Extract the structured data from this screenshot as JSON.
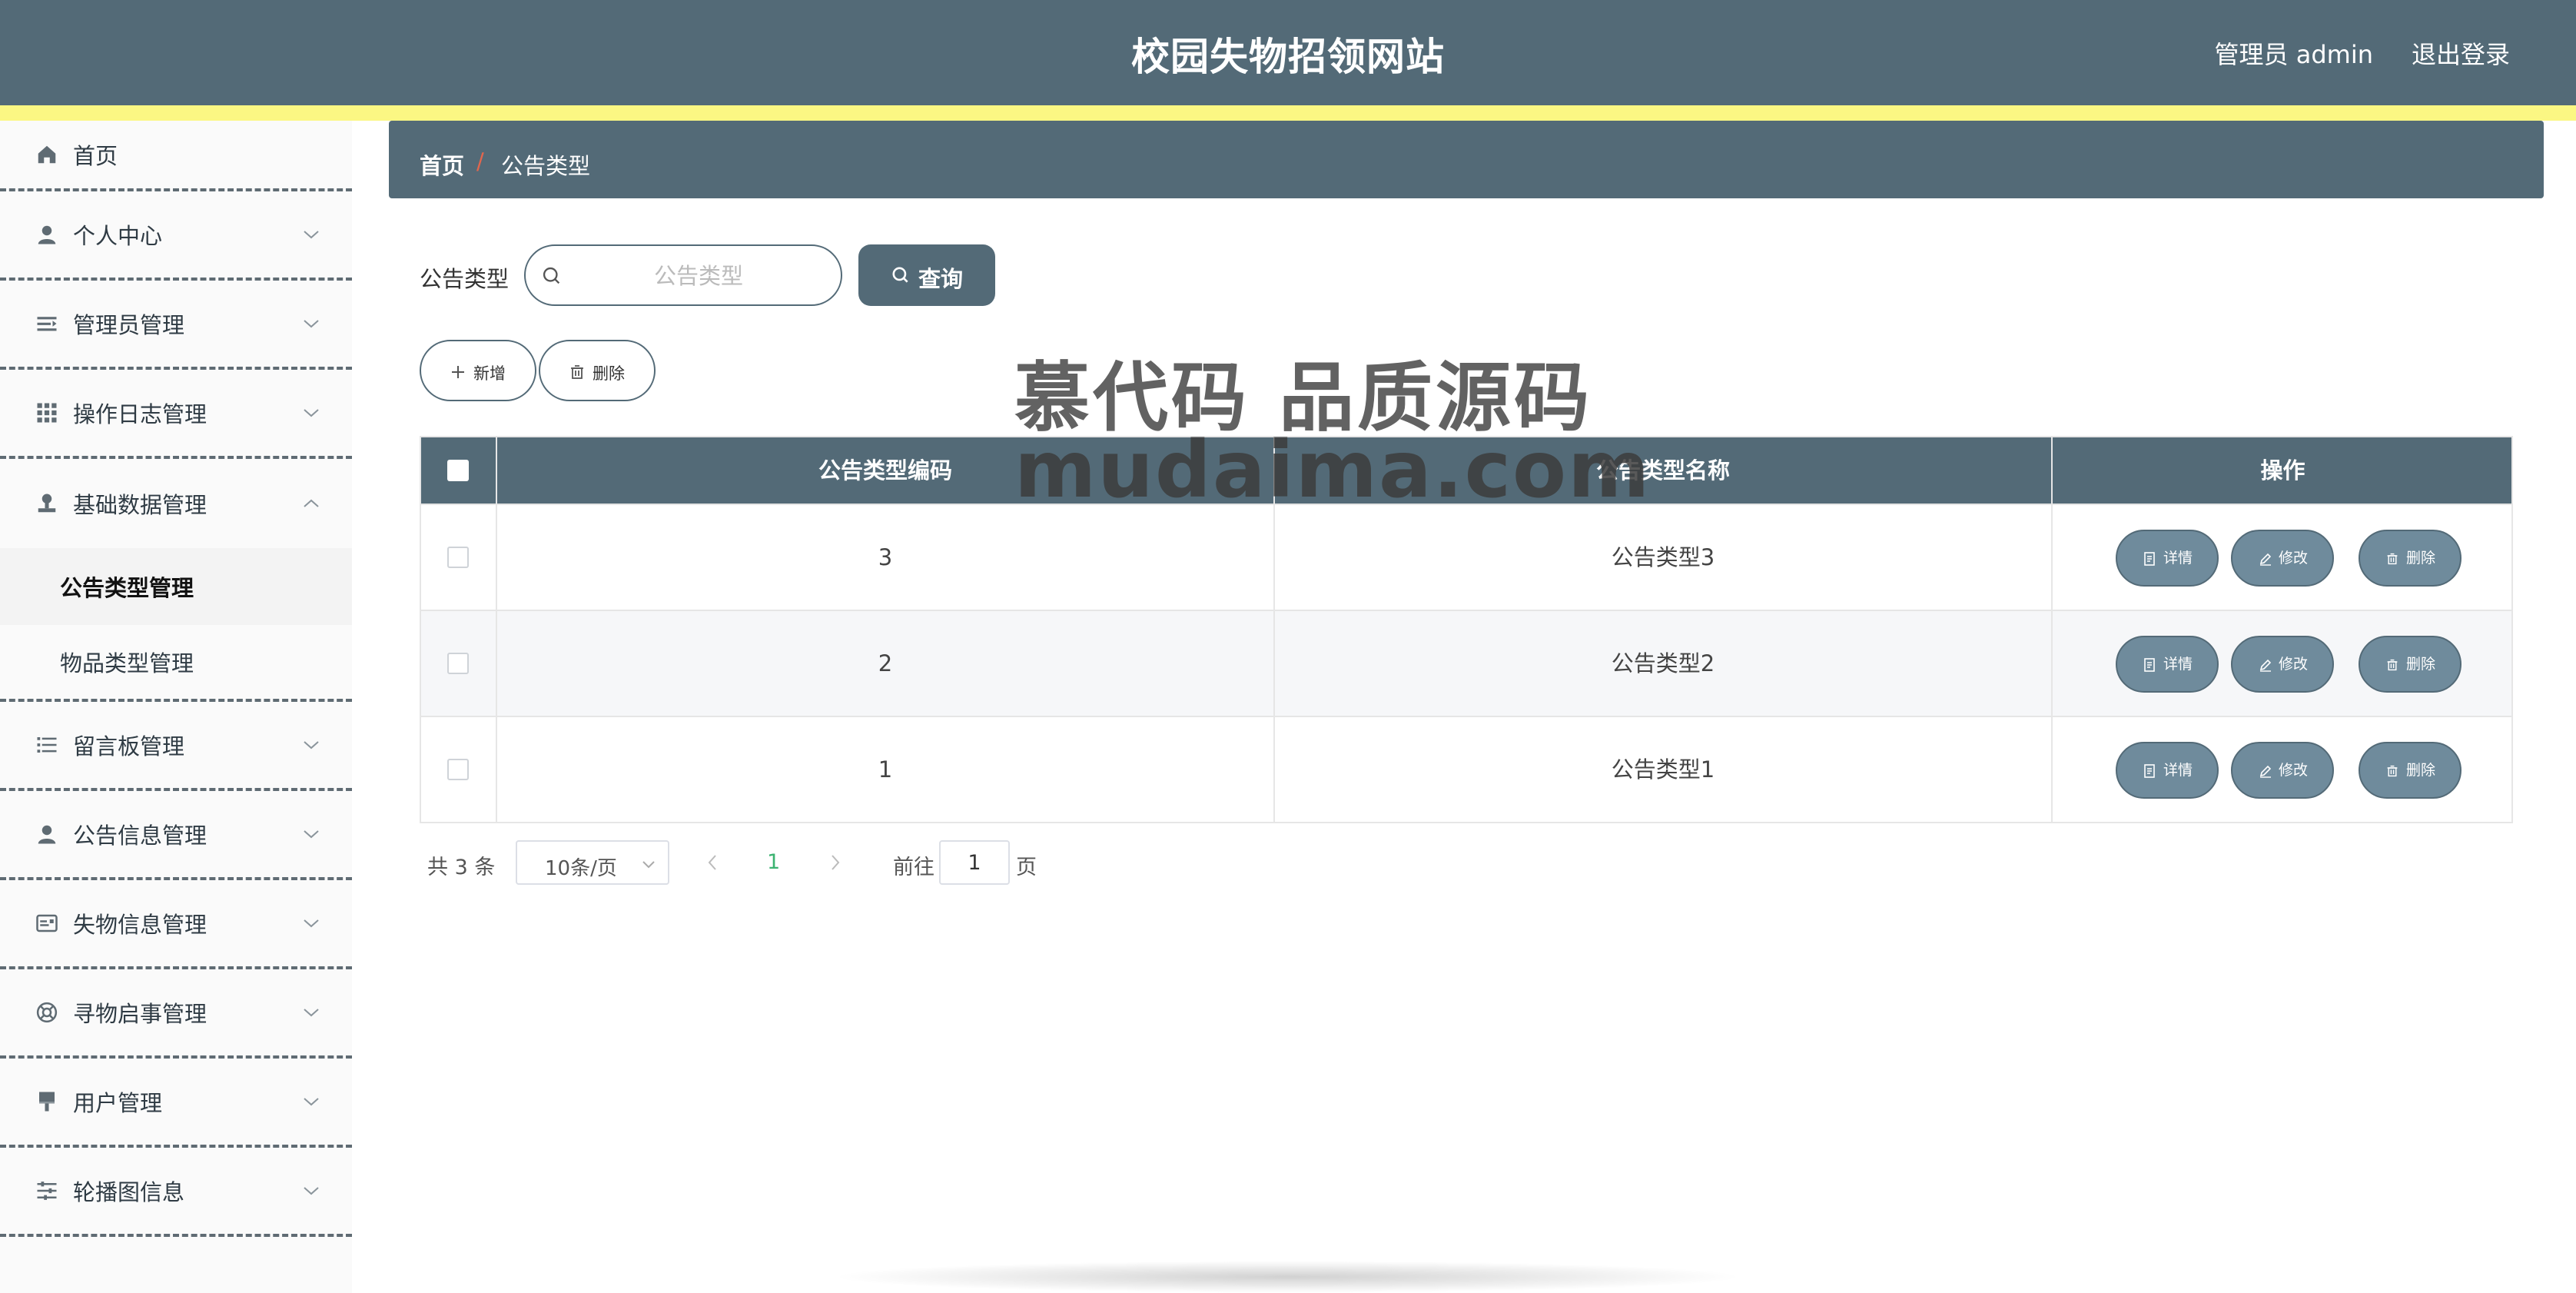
{
  "header": {
    "title": "校园失物招领网站",
    "user": "管理员 admin",
    "logout": "退出登录"
  },
  "sidebar": {
    "items": [
      {
        "label": "首页",
        "icon": "home-icon"
      },
      {
        "label": "个人中心",
        "icon": "user-icon"
      },
      {
        "label": "管理员管理",
        "icon": "admin-list-icon"
      },
      {
        "label": "操作日志管理",
        "icon": "grid-icon"
      },
      {
        "label": "基础数据管理",
        "icon": "stamp-icon",
        "expanded": true
      },
      {
        "label": "留言板管理",
        "icon": "list-icon"
      },
      {
        "label": "公告信息管理",
        "icon": "person-icon"
      },
      {
        "label": "失物信息管理",
        "icon": "card-icon"
      },
      {
        "label": "寻物启事管理",
        "icon": "lifebuoy-icon"
      },
      {
        "label": "用户管理",
        "icon": "brush-icon"
      },
      {
        "label": "轮播图信息",
        "icon": "sliders-icon"
      }
    ],
    "subitems": [
      {
        "label": "公告类型管理",
        "active": true
      },
      {
        "label": "物品类型管理",
        "active": false
      }
    ]
  },
  "breadcrumb": {
    "home": "首页",
    "separator": "/",
    "current": "公告类型"
  },
  "search": {
    "label": "公告类型",
    "placeholder": "公告类型",
    "value": "",
    "button": "查询"
  },
  "toolbar": {
    "add": "新增",
    "delete": "删除"
  },
  "table": {
    "headers": [
      "公告类型编码",
      "公告类型名称",
      "操作"
    ],
    "rows": [
      {
        "code": "3",
        "name": "公告类型3"
      },
      {
        "code": "2",
        "name": "公告类型2"
      },
      {
        "code": "1",
        "name": "公告类型1"
      }
    ],
    "actions": {
      "detail": "详情",
      "edit": "修改",
      "delete": "删除"
    }
  },
  "pagination": {
    "total": "共 3 条",
    "page_size": "10条/页",
    "current_page": "1",
    "goto_label": "前往",
    "goto_value": "1",
    "page_suffix": "页"
  },
  "watermark": {
    "line1": "慕代码 品质源码",
    "line2": "mudaima.com"
  },
  "colors": {
    "header": "#536a77",
    "stripe": "#fbf783",
    "action_button": "#6f8b9c",
    "active_page": "#3cb371"
  }
}
